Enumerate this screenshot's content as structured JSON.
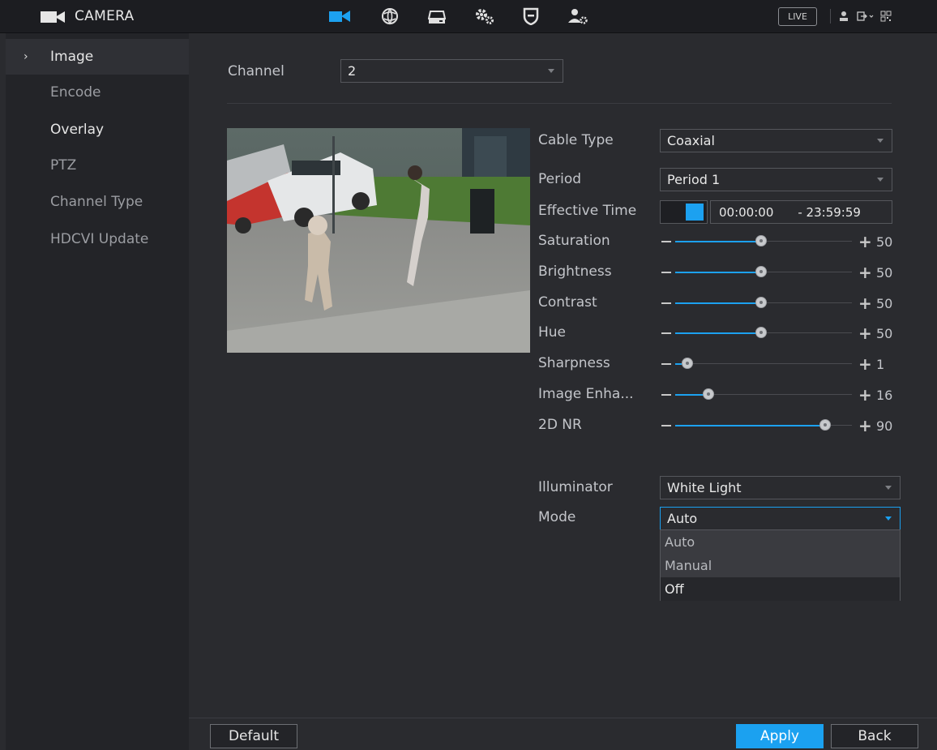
{
  "topbar": {
    "title": "CAMERA",
    "live_label": "LIVE",
    "icons": [
      "camera-icon",
      "network-icon",
      "storage-icon",
      "system-icon",
      "security-icon",
      "account-icon"
    ],
    "accent_color": "#1ca1f0"
  },
  "sidebar": {
    "items": [
      {
        "label": "Image"
      },
      {
        "label": "Encode"
      },
      {
        "label": "Overlay"
      },
      {
        "label": "PTZ"
      },
      {
        "label": "Channel Type"
      },
      {
        "label": "HDCVI Update"
      }
    ]
  },
  "main": {
    "channel_label": "Channel",
    "channel_value": "2",
    "cable_type_label": "Cable Type",
    "cable_type_value": "Coaxial",
    "period_label": "Period",
    "period_value": "Period 1",
    "effective_time_label": "Effective Time",
    "time_start": "00:00:00",
    "time_end": "- 23:59:59",
    "sliders": [
      {
        "label": "Saturation",
        "value": "50"
      },
      {
        "label": "Brightness",
        "value": "50"
      },
      {
        "label": "Contrast",
        "value": "50"
      },
      {
        "label": "Hue",
        "value": "50"
      },
      {
        "label": "Sharpness",
        "value": "1"
      },
      {
        "label": "Image Enha...",
        "value": "16"
      },
      {
        "label": "2D NR",
        "value": "90"
      }
    ],
    "illuminator_label": "Illuminator",
    "illuminator_value": "White Light",
    "mode_label": "Mode",
    "mode_value": "Auto",
    "mode_options": [
      "Auto",
      "Manual",
      "Off"
    ]
  },
  "footer": {
    "default_label": "Default",
    "apply_label": "Apply",
    "back_label": "Back"
  }
}
